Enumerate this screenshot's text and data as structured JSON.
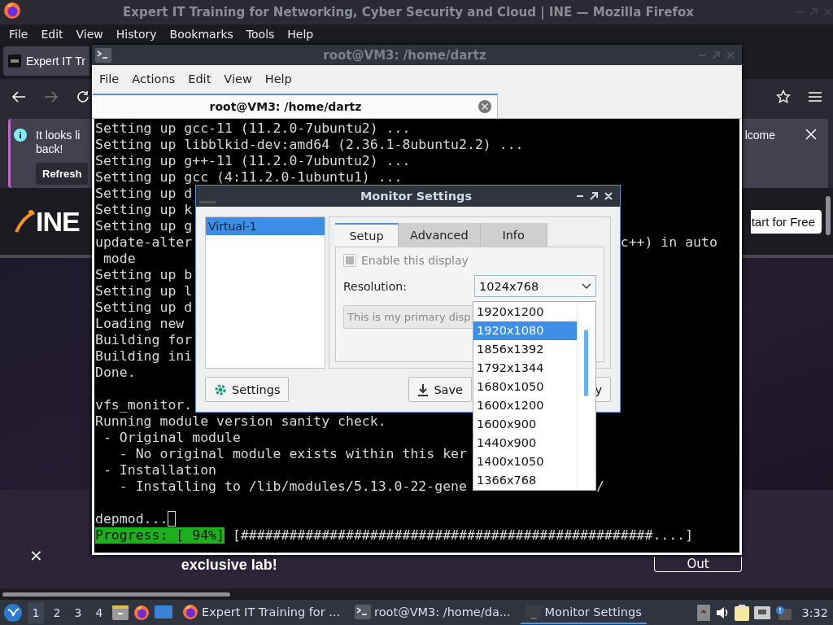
{
  "firefox": {
    "title": "Expert IT Training for Networking, Cyber Security and Cloud | INE — Mozilla Firefox",
    "menu": [
      "File",
      "Edit",
      "View",
      "History",
      "Bookmarks",
      "Tools",
      "Help"
    ],
    "tab": "Expert IT Tr",
    "notice": {
      "lines": [
        "It looks li",
        "back!"
      ],
      "button": "Refresh",
      "tail": "lcome"
    },
    "page": {
      "logo": "INE",
      "cta": "tart for Free",
      "banner_close": "×",
      "banner_text": "exclusive lab!",
      "banner_button": "Out"
    }
  },
  "terminal": {
    "title": "root@VM3: /home/dartz",
    "menu": [
      "File",
      "Actions",
      "Edit",
      "View",
      "Help"
    ],
    "tab": "root@VM3: /home/dartz",
    "lines": [
      {
        "kind": "text",
        "text": "Setting up gcc-11 (11.2.0-7ubuntu2) ..."
      },
      {
        "kind": "text",
        "text": "Setting up libblkid-dev:amd64 (2.36.1-8ubuntu2.2) ..."
      },
      {
        "kind": "text",
        "text": "Setting up g++-11 (11.2.0-7ubuntu2) ..."
      },
      {
        "kind": "text",
        "text": "Setting up gcc (4:11.2.0-1ubuntu1) ..."
      },
      {
        "kind": "text",
        "text": "Setting up d"
      },
      {
        "kind": "text",
        "text": "Setting up k"
      },
      {
        "kind": "text",
        "text": "Setting up g"
      },
      {
        "kind": "text",
        "text": "update-alter",
        "tail": "c++) in auto"
      },
      {
        "kind": "text",
        "text": " mode"
      },
      {
        "kind": "text",
        "text": "Setting up b"
      },
      {
        "kind": "text",
        "text": "Setting up l"
      },
      {
        "kind": "text",
        "text": "Setting up d"
      },
      {
        "kind": "text",
        "text": "Loading new"
      },
      {
        "kind": "text",
        "text": "Building for"
      },
      {
        "kind": "text",
        "text": "Building ini"
      },
      {
        "kind": "text",
        "text": "Done."
      },
      {
        "kind": "blank"
      },
      {
        "kind": "text",
        "text": "vfs_monitor."
      },
      {
        "kind": "text",
        "text": "Running module version sanity check."
      },
      {
        "kind": "text",
        "text": " - Original module"
      },
      {
        "kind": "text",
        "text": "   - No original module exists within this ker"
      },
      {
        "kind": "text",
        "text": " - Installation"
      },
      {
        "kind": "text",
        "text": "   - Installing to /lib/modules/5.13.0-22-gene",
        "tail": "/"
      },
      {
        "kind": "blank"
      },
      {
        "kind": "cursor",
        "text": "depmod..."
      },
      {
        "kind": "progress",
        "label": "Progress: [ 94%]",
        "bar": "[###################################################....]"
      }
    ]
  },
  "dialog": {
    "title": "Monitor Settings",
    "outputs": [
      {
        "label": "Virtual-1",
        "selected": true
      }
    ],
    "tabs": [
      {
        "label": "Setup",
        "selected": true
      },
      {
        "label": "Advanced",
        "selected": false
      },
      {
        "label": "Info",
        "selected": false
      }
    ],
    "enable": {
      "label": "Enable this display",
      "checked": true,
      "disabled": true
    },
    "resolution_label": "Resolution:",
    "resolution_value": "1024x768",
    "primary_button": "This is my primary disp",
    "settings_button": "Settings",
    "save_button": "Save",
    "button_3": "y",
    "options": [
      {
        "label": "1920x1200",
        "selected": false
      },
      {
        "label": "1920x1080",
        "selected": true
      },
      {
        "label": "1856x1392",
        "selected": false
      },
      {
        "label": "1792x1344",
        "selected": false
      },
      {
        "label": "1680x1050",
        "selected": false
      },
      {
        "label": "1600x1200",
        "selected": false
      },
      {
        "label": "1600x900",
        "selected": false
      },
      {
        "label": "1440x900",
        "selected": false
      },
      {
        "label": "1400x1050",
        "selected": false
      },
      {
        "label": "1366x768",
        "selected": false
      }
    ]
  },
  "taskbar": {
    "workspaces": [
      {
        "label": "1",
        "selected": true
      },
      {
        "label": "2",
        "selected": false
      },
      {
        "label": "3",
        "selected": false
      },
      {
        "label": "4",
        "selected": false
      }
    ],
    "tasks": [
      {
        "label": "Expert IT Training for ...",
        "selected": false
      },
      {
        "label": "root@VM3: /home/da...",
        "selected": false
      },
      {
        "label": "Monitor Settings",
        "selected": true
      }
    ],
    "clock": "3:32"
  }
}
